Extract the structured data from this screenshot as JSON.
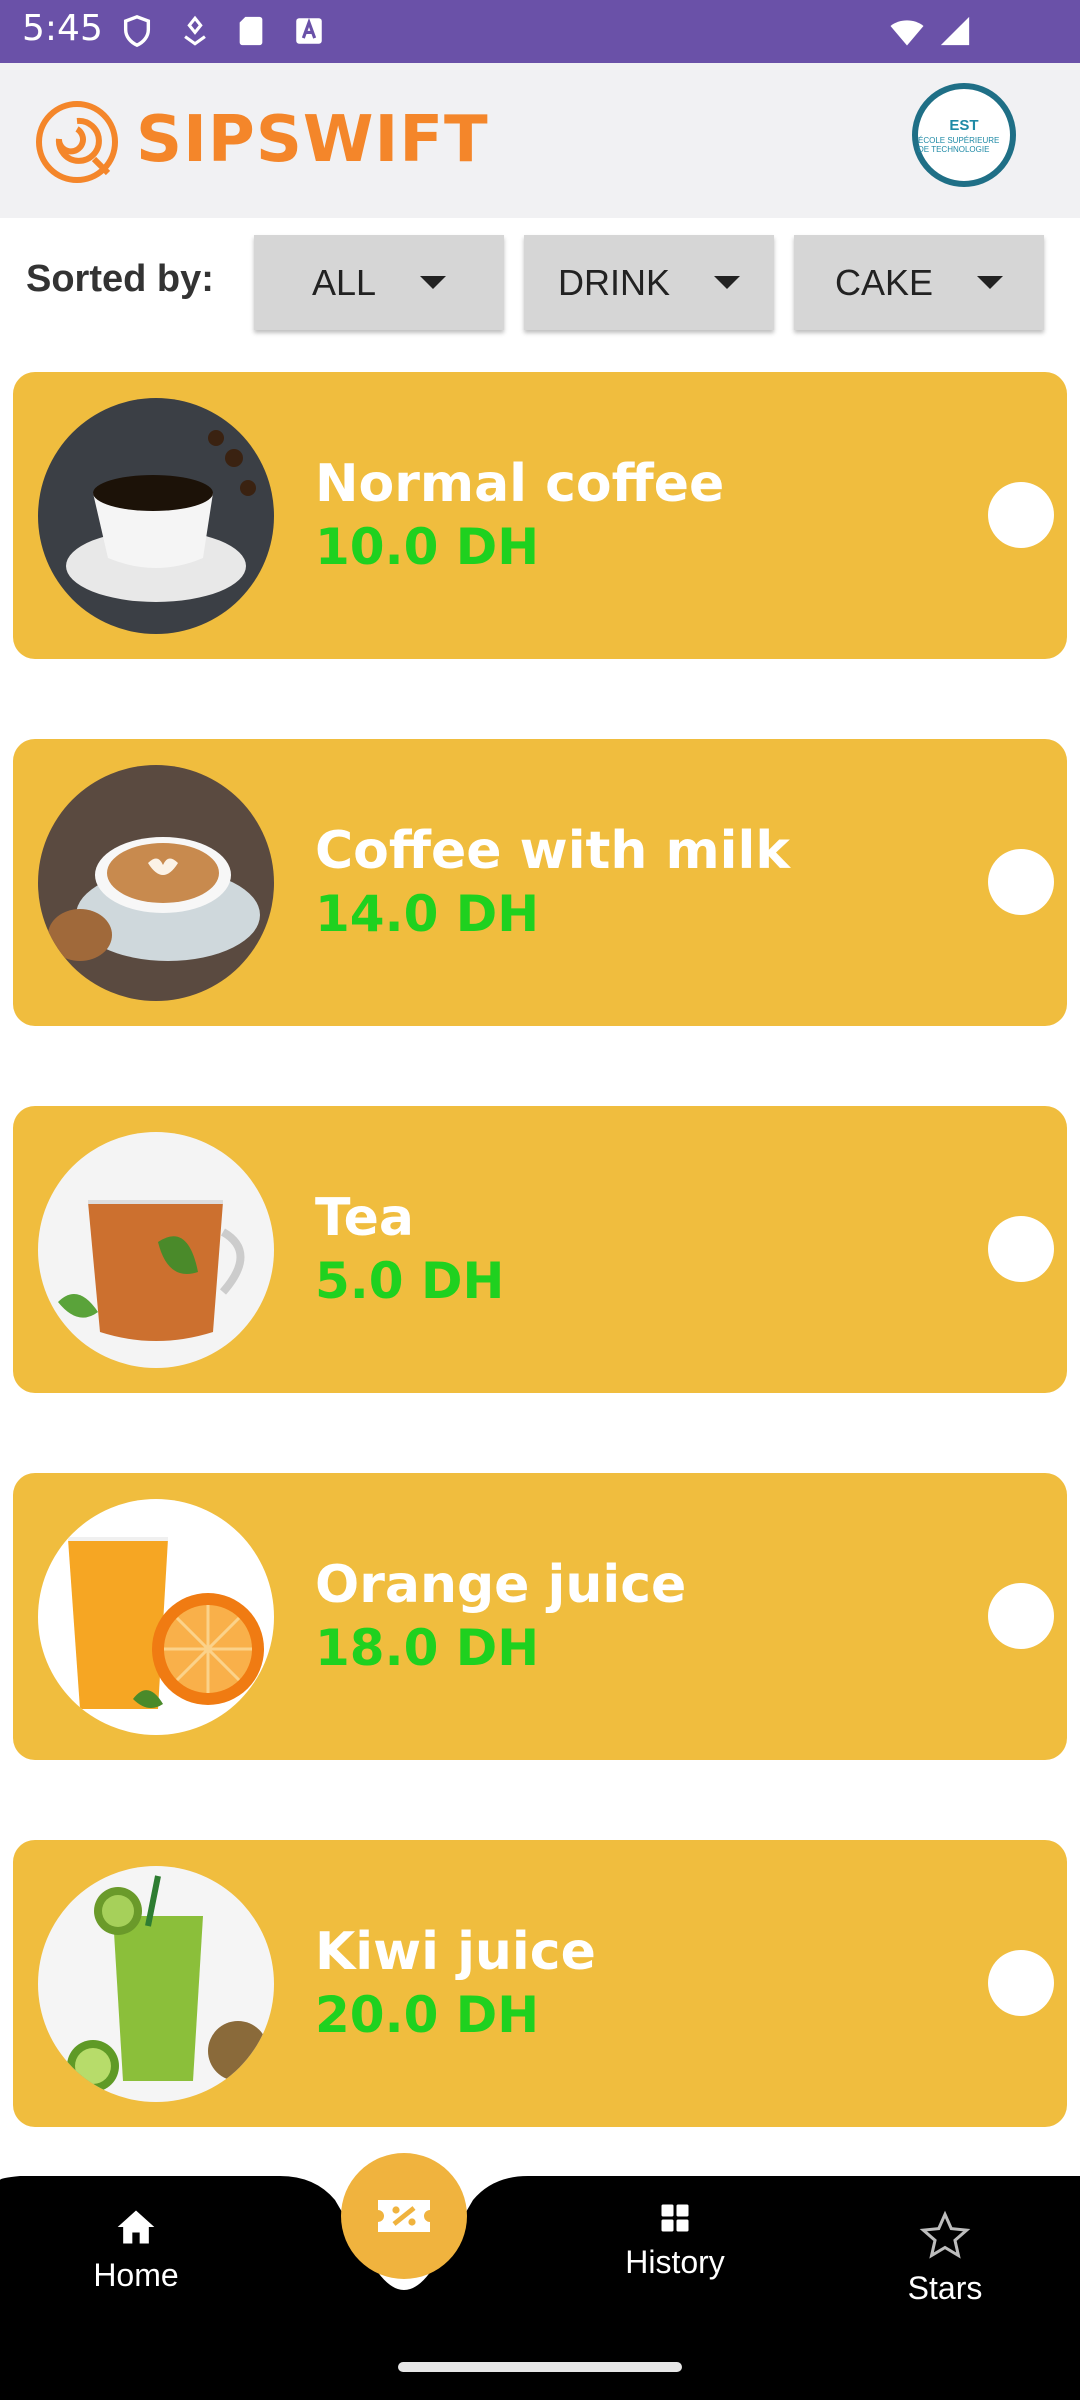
{
  "status_bar": {
    "time": "5:45"
  },
  "header": {
    "brand": "SIPSWIFT",
    "school_logo_text": "EST",
    "school_logo_sub": "ÉCOLE SUPÉRIEURE DE TECHNOLOGIE"
  },
  "filters": {
    "label": "Sorted by:",
    "buttons": [
      {
        "label": "ALL"
      },
      {
        "label": "DRINK"
      },
      {
        "label": "CAKE"
      }
    ]
  },
  "items": [
    {
      "name": "Normal coffee",
      "price": "10.0 DH",
      "icon": "coffee-cup-image"
    },
    {
      "name": "Coffee with milk",
      "price": "14.0 DH",
      "icon": "latte-image"
    },
    {
      "name": "Tea",
      "price": "5.0 DH",
      "icon": "tea-glass-image"
    },
    {
      "name": "Orange juice",
      "price": "18.0 DH",
      "icon": "orange-juice-image"
    },
    {
      "name": "Kiwi juice",
      "price": "20.0 DH",
      "icon": "kiwi-juice-image"
    }
  ],
  "bottom_nav": {
    "home": "Home",
    "history": "History",
    "stars": "Stars",
    "fab_icon": "discount-ticket-icon"
  },
  "colors": {
    "status_bar": "#6a51a8",
    "brand": "#f4862a",
    "card": "#f0bd3e",
    "price": "#1fd11f",
    "nav_bg": "#000000",
    "fab": "#f0b33e"
  }
}
